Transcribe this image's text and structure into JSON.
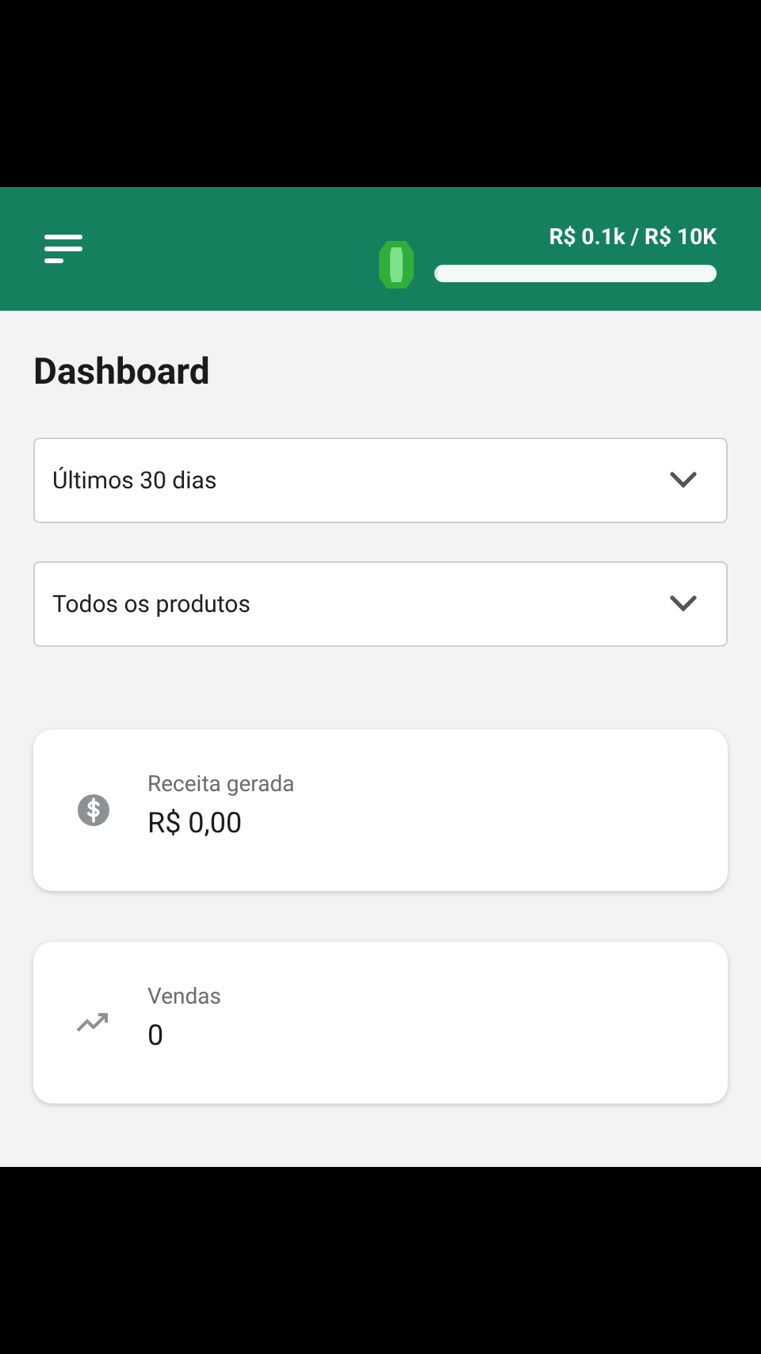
{
  "header": {
    "goal_text": "R$ 0.1k / R$ 10K",
    "goal": {
      "level": 0.01
    }
  },
  "title": "Dashboard",
  "filters": [
    {
      "value": "Últimos 30 dias"
    },
    {
      "value": "Todos os produtos"
    }
  ],
  "stats": [
    {
      "kind": "money",
      "label": "Receita gerada",
      "value": "R$ 0,00"
    },
    {
      "kind": "trend",
      "label": "Vendas",
      "value": "0"
    }
  ]
}
